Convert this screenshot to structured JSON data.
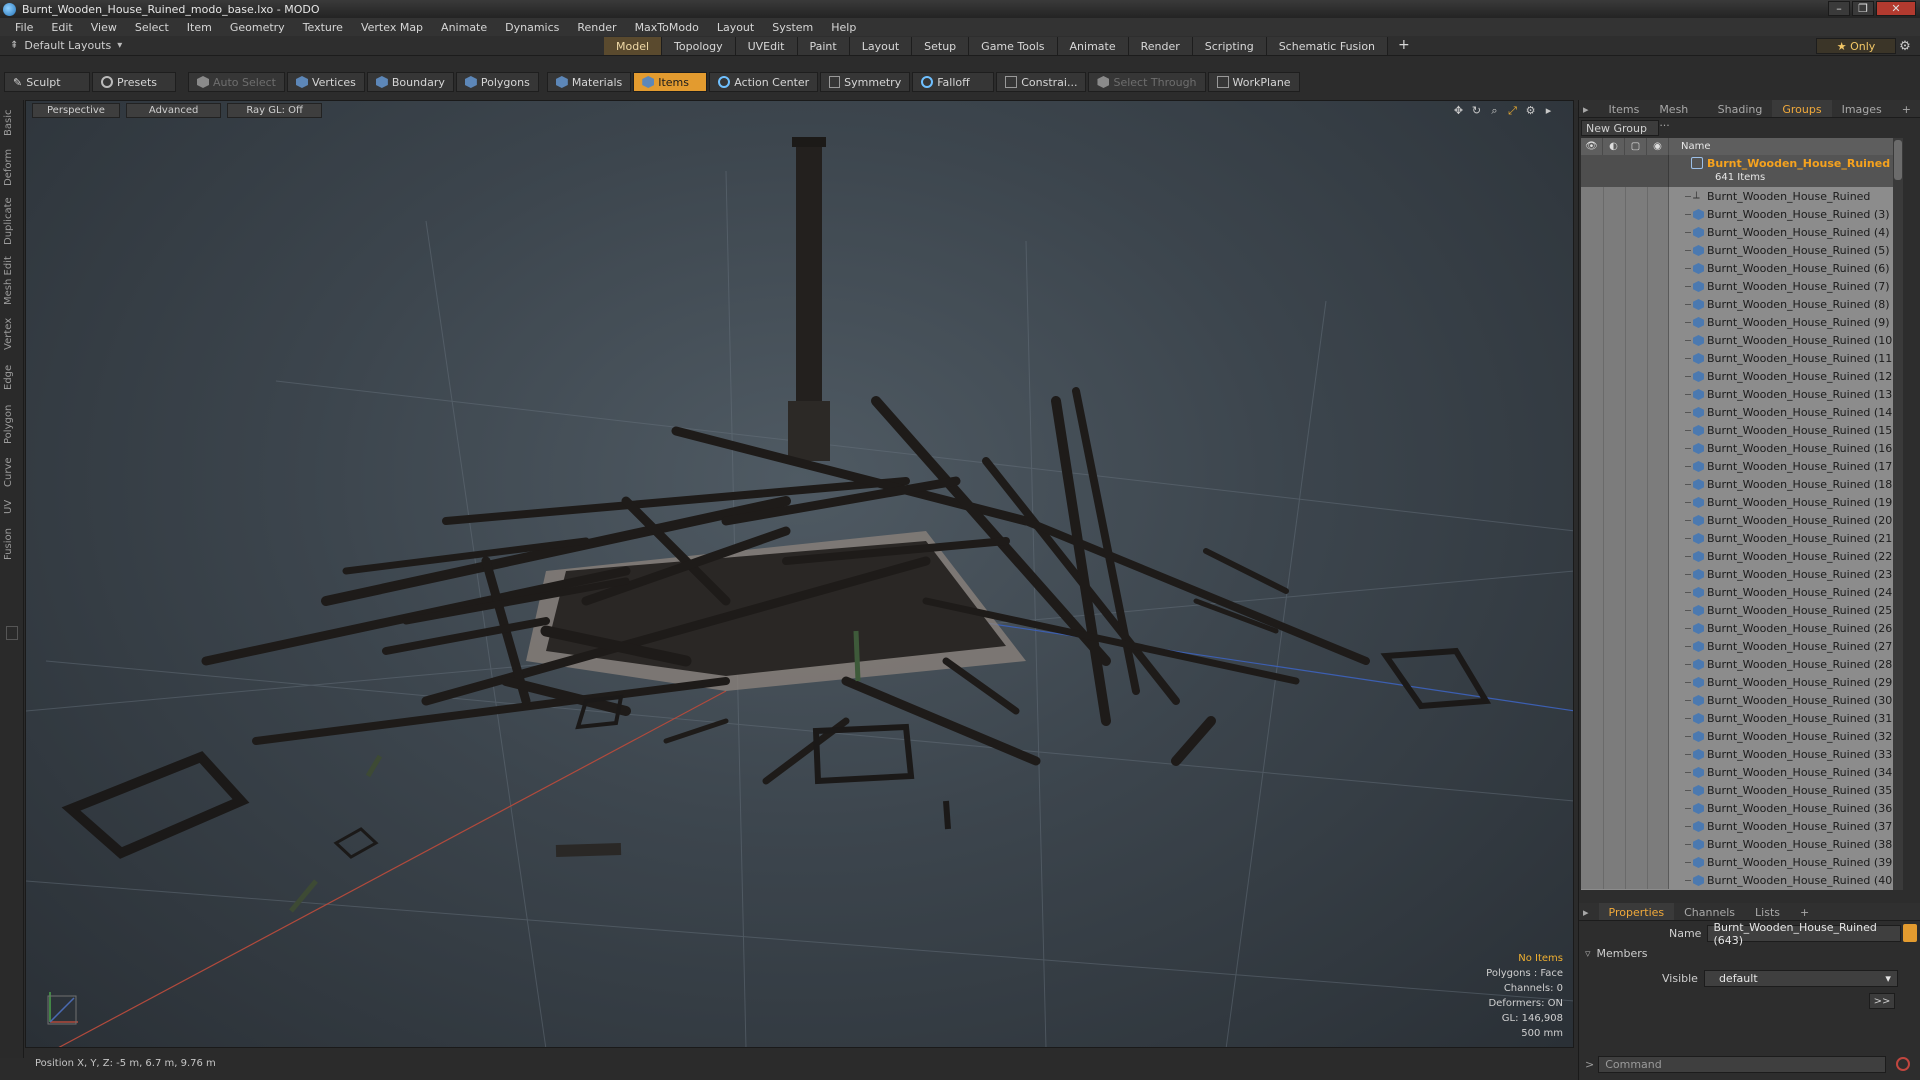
{
  "window": {
    "title": "Burnt_Wooden_House_Ruined_modo_base.lxo - MODO",
    "controls": [
      "–",
      "❐",
      "✕"
    ]
  },
  "menu": [
    "File",
    "Edit",
    "View",
    "Select",
    "Item",
    "Geometry",
    "Texture",
    "Vertex Map",
    "Animate",
    "Dynamics",
    "Render",
    "MaxToModo",
    "Layout",
    "System",
    "Help"
  ],
  "layoutbar": {
    "layouts_label": "Default Layouts",
    "tabs": [
      "Model",
      "Topology",
      "UVEdit",
      "Paint",
      "Layout",
      "Setup",
      "Game Tools",
      "Animate",
      "Render",
      "Scripting",
      "Schematic Fusion"
    ],
    "active_tab": "Model",
    "add_tab": "+",
    "only_label": "★  Only",
    "gear_icon": "⚙"
  },
  "toolbar": {
    "sculpt": "Sculpt",
    "presets": "Presets",
    "auto_select": "Auto Select",
    "vertices": "Vertices",
    "boundary": "Boundary",
    "polygons": "Polygons",
    "materials": "Materials",
    "items": "Items",
    "action_center": "Action Center",
    "symmetry": "Symmetry",
    "falloff": "Falloff",
    "constraints": "Constrai...",
    "select_through": "Select Through",
    "workplane": "WorkPlane"
  },
  "left_tabs": [
    "Basic",
    "Deform",
    "Duplicate",
    "Mesh Edit",
    "Vertex",
    "Edge",
    "Polygon",
    "Curve",
    "UV",
    "Fusion"
  ],
  "viewport": {
    "perspective": "Perspective",
    "advanced": "Advanced",
    "raygl": "Ray GL: Off",
    "info": {
      "no_items": "No Items",
      "polygons": "Polygons : Face",
      "channels": "Channels: 0",
      "deformers": "Deformers: ON",
      "gl": "GL: 146,908",
      "scale": "500 mm"
    }
  },
  "status": {
    "position": "Position X, Y, Z:  -5 m, 6.7 m, 9.76 m"
  },
  "rightpanel": {
    "tabs": [
      "Items",
      "Mesh ...",
      "Shading",
      "Groups",
      "Images"
    ],
    "active_tab": "Groups",
    "new_group": "New Group",
    "name_header": "Name",
    "group": {
      "name": "Burnt_Wooden_House_Ruined",
      "count": "641 Items"
    },
    "items": [
      "Burnt_Wooden_House_Ruined",
      "Burnt_Wooden_House_Ruined (3)",
      "Burnt_Wooden_House_Ruined (4)",
      "Burnt_Wooden_House_Ruined (5)",
      "Burnt_Wooden_House_Ruined (6)",
      "Burnt_Wooden_House_Ruined (7)",
      "Burnt_Wooden_House_Ruined (8)",
      "Burnt_Wooden_House_Ruined (9)",
      "Burnt_Wooden_House_Ruined (10)",
      "Burnt_Wooden_House_Ruined (11)",
      "Burnt_Wooden_House_Ruined (12)",
      "Burnt_Wooden_House_Ruined (13)",
      "Burnt_Wooden_House_Ruined (14)",
      "Burnt_Wooden_House_Ruined (15)",
      "Burnt_Wooden_House_Ruined (16)",
      "Burnt_Wooden_House_Ruined (17)",
      "Burnt_Wooden_House_Ruined (18)",
      "Burnt_Wooden_House_Ruined (19)",
      "Burnt_Wooden_House_Ruined (20)",
      "Burnt_Wooden_House_Ruined (21)",
      "Burnt_Wooden_House_Ruined (22)",
      "Burnt_Wooden_House_Ruined (23)",
      "Burnt_Wooden_House_Ruined (24)",
      "Burnt_Wooden_House_Ruined (25)",
      "Burnt_Wooden_House_Ruined (26)",
      "Burnt_Wooden_House_Ruined (27)",
      "Burnt_Wooden_House_Ruined (28)",
      "Burnt_Wooden_House_Ruined (29)",
      "Burnt_Wooden_House_Ruined (30)",
      "Burnt_Wooden_House_Ruined (31)",
      "Burnt_Wooden_House_Ruined (32)",
      "Burnt_Wooden_House_Ruined (33)",
      "Burnt_Wooden_House_Ruined (34)",
      "Burnt_Wooden_House_Ruined (35)",
      "Burnt_Wooden_House_Ruined (36)",
      "Burnt_Wooden_House_Ruined (37)",
      "Burnt_Wooden_House_Ruined (38)",
      "Burnt_Wooden_House_Ruined (39)",
      "Burnt_Wooden_House_Ruined (40)"
    ],
    "props_tabs": [
      "Properties",
      "Channels",
      "Lists"
    ],
    "props_active": "Properties",
    "name_label": "Name",
    "name_value": "Burnt_Wooden_House_Ruined (643)",
    "members_label": "Members",
    "visible_label": "Visible",
    "visible_value": "default",
    "more_btn": ">>",
    "command_placeholder": "Command",
    "cmd_prompt": ">"
  },
  "colors": {
    "accent": "#e39b2f",
    "group_name": "#f5a21e"
  }
}
